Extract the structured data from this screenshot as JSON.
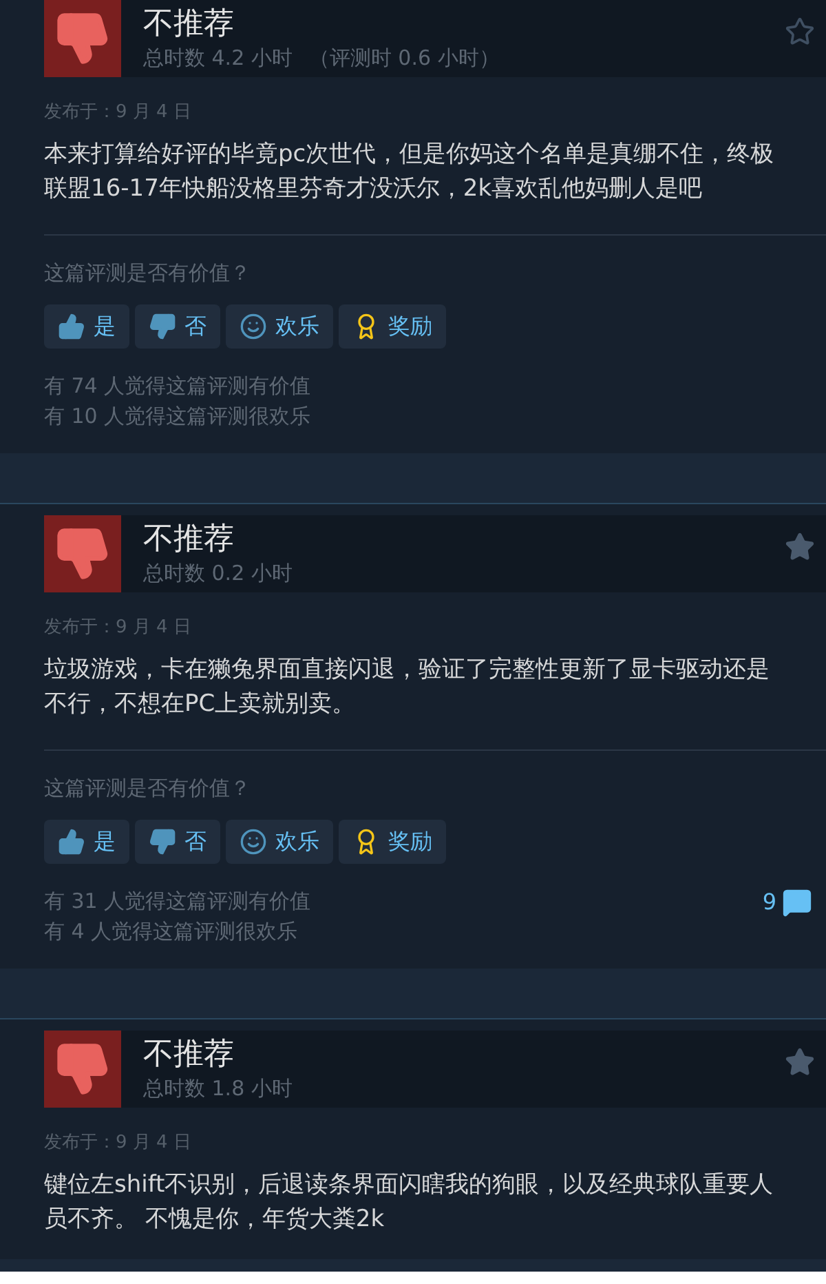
{
  "reviews": [
    {
      "verdict": "不推荐",
      "hours": "总时数 4.2 小时",
      "hours_at_review": "（评测时 0.6 小时）",
      "starred": false,
      "posted": "发布于：9 月 4 日",
      "text": "本来打算给好评的毕竟pc次世代，但是你妈这个名单是真绷不住，终极联盟16-17年快船没格里芬奇才没沃尔，2k喜欢乱他妈删人是吧",
      "question": "这篇评测是否有价值？",
      "buttons": [
        {
          "kind": "yes",
          "label": "是"
        },
        {
          "kind": "no",
          "label": "否"
        },
        {
          "kind": "funny",
          "label": "欢乐"
        },
        {
          "kind": "award",
          "label": "奖励"
        }
      ],
      "helpful": "有 74 人觉得这篇评测有价值",
      "funny": "有 10 人觉得这篇评测很欢乐"
    },
    {
      "verdict": "不推荐",
      "hours": "总时数 0.2 小时",
      "starred": true,
      "posted": "发布于：9 月 4 日",
      "text": "垃圾游戏，卡在獭兔界面直接闪退，验证了完整性更新了显卡驱动还是不行，不想在PC上卖就别卖。",
      "question": "这篇评测是否有价值？",
      "buttons": [
        {
          "kind": "yes",
          "label": "是"
        },
        {
          "kind": "no",
          "label": "否"
        },
        {
          "kind": "funny",
          "label": "欢乐"
        },
        {
          "kind": "award",
          "label": "奖励"
        }
      ],
      "helpful": "有 31 人觉得这篇评测有价值",
      "funny": "有 4 人觉得这篇评测很欢乐",
      "comments": "9"
    },
    {
      "verdict": "不推荐",
      "hours": "总时数 1.8 小时",
      "starred": true,
      "posted": "发布于：9 月 4 日",
      "text": "键位左shift不识别，后退读条界面闪瞎我的狗眼，以及经典球队重要人员不齐。 不愧是你，年货大粪2k"
    }
  ]
}
